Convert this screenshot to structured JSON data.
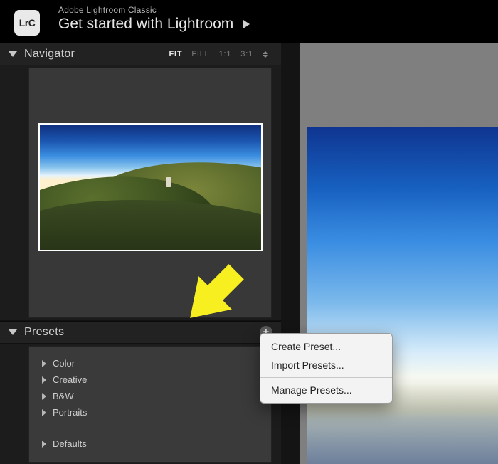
{
  "header": {
    "app_icon_text": "LrC",
    "app_name": "Adobe Lightroom Classic",
    "headline": "Get started with Lightroom"
  },
  "navigator": {
    "title": "Navigator",
    "modes": {
      "fit": "FIT",
      "fill": "FILL",
      "one_to_one": "1:1",
      "custom": "3:1"
    }
  },
  "presets": {
    "title": "Presets",
    "groups": [
      "Color",
      "Creative",
      "B&W",
      "Portraits"
    ],
    "defaults_label": "Defaults",
    "plus_label": "+"
  },
  "context_menu": {
    "create": "Create Preset...",
    "import": "Import Presets...",
    "manage": "Manage Presets..."
  }
}
